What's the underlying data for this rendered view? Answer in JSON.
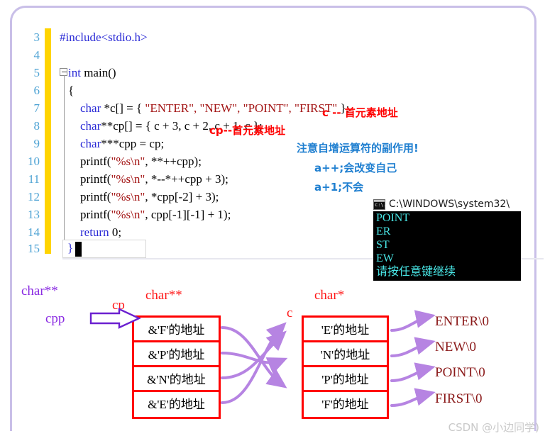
{
  "editor": {
    "line_numbers": [
      "3",
      "4",
      "5",
      "6",
      "7",
      "8",
      "9",
      "10",
      "11",
      "12",
      "13",
      "14",
      "15"
    ],
    "lines": [
      {
        "n": "3",
        "segments": [
          {
            "t": "#include",
            "c": "kw"
          },
          {
            "t": "<stdio.h>",
            "c": "kw"
          }
        ]
      },
      {
        "n": "4",
        "segments": []
      },
      {
        "n": "5",
        "segments": [
          {
            "t": "int",
            "c": "kw"
          },
          {
            "t": " main()",
            "c": "plain"
          }
        ]
      },
      {
        "n": "6",
        "segments": [
          {
            "t": "{",
            "c": "plain"
          }
        ]
      },
      {
        "n": "7",
        "segments": [
          {
            "t": "    char",
            "c": "kw"
          },
          {
            "t": " *c[] = { ",
            "c": "plain"
          },
          {
            "t": "\"ENTER\", \"NEW\", \"POINT\", \"FIRST\"",
            "c": "str"
          },
          {
            "t": " };",
            "c": "plain"
          }
        ]
      },
      {
        "n": "8",
        "segments": [
          {
            "t": "    char",
            "c": "kw"
          },
          {
            "t": "**cp[] = { c + 3, c + 2, c + 1, c };",
            "c": "plain"
          }
        ]
      },
      {
        "n": "9",
        "segments": [
          {
            "t": "    char",
            "c": "kw"
          },
          {
            "t": "***cpp = cp;",
            "c": "plain"
          }
        ]
      },
      {
        "n": "10",
        "segments": [
          {
            "t": "    printf(",
            "c": "plain"
          },
          {
            "t": "\"%s\\n\"",
            "c": "str"
          },
          {
            "t": ", **++cpp);",
            "c": "plain"
          }
        ]
      },
      {
        "n": "11",
        "segments": [
          {
            "t": "    printf(",
            "c": "plain"
          },
          {
            "t": "\"%s\\n\"",
            "c": "str"
          },
          {
            "t": ", *--*++cpp + 3);",
            "c": "plain"
          }
        ]
      },
      {
        "n": "12",
        "segments": [
          {
            "t": "    printf(",
            "c": "plain"
          },
          {
            "t": "\"%s\\n\"",
            "c": "str"
          },
          {
            "t": ", *cpp[-2] + 3);",
            "c": "plain"
          }
        ]
      },
      {
        "n": "13",
        "segments": [
          {
            "t": "    printf(",
            "c": "plain"
          },
          {
            "t": "\"%s\\n\"",
            "c": "str"
          },
          {
            "t": ", cpp[-1][-1] + 1);",
            "c": "plain"
          }
        ]
      },
      {
        "n": "14",
        "segments": [
          {
            "t": "    return",
            "c": "kw"
          },
          {
            "t": " 0;",
            "c": "plain"
          }
        ]
      },
      {
        "n": "15",
        "segments": [
          {
            "t": "}",
            "c": "plain"
          }
        ]
      }
    ],
    "caret_text": "}",
    "annotations": {
      "c_first_elem": "c -- 首元素地址",
      "cp_first_elem": "cp--首元素地址",
      "increment_note": "注意自增运算符的副作用!",
      "a_plus_plus": "a++;会改变自己",
      "a_plus_one": "a+1;不会"
    }
  },
  "console": {
    "title": "C:\\WINDOWS\\system32\\",
    "icon": "cmd-icon",
    "output": [
      "POINT",
      "ER",
      "ST",
      "EW",
      "请按任意键继续"
    ]
  },
  "diagram": {
    "left_type_label": "char**",
    "cpp_label": "cpp",
    "cp_label": "cp",
    "mid_type_label": "char**",
    "c_label": "c",
    "right_type_label": "char*",
    "cp_boxes": [
      "&'F'的地址",
      "&'P'的地址",
      "&'N'的地址",
      "&'E'的地址"
    ],
    "c_boxes": [
      "'E'的地址",
      "'N'的地址",
      "'P'的地址",
      "'F'的地址"
    ],
    "strings": [
      "ENTER\\0",
      "NEW\\0",
      "POINT\\0",
      "FIRST\\0"
    ]
  },
  "watermark": "CSDN @小边同学)",
  "colors": {
    "keyword": "#2b2bd6",
    "string": "#a31515",
    "line_number": "#4ea3d4",
    "change_bar": "#ffd400",
    "box_border": "#ff0000",
    "arrow_purple": "#b07ae0",
    "label_purple": "#8a2be2",
    "note_red": "#ff0000",
    "note_blue": "#1f7fd0",
    "console_text": "#49e6e6",
    "frame": "#c9bfe8"
  }
}
